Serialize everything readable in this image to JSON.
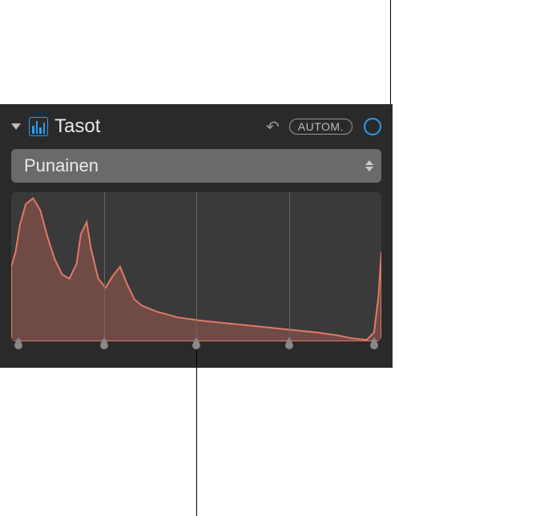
{
  "panel": {
    "title": "Tasot",
    "auto_label": "AUTOM.",
    "channel_selected": "Punainen"
  },
  "histogram": {
    "grid_positions_pct": [
      25,
      50,
      75
    ],
    "slider_positions_pct": [
      2,
      25,
      50,
      75,
      98
    ],
    "channel_color": "#d66a5a",
    "fill_color": "rgba(214,106,90,0.35)",
    "stroke_color": "#e07a68"
  },
  "chart_data": {
    "type": "area",
    "title": "",
    "xlabel": "",
    "ylabel": "",
    "x_range": [
      0,
      255
    ],
    "y_range": [
      0,
      100
    ],
    "series": [
      {
        "name": "Punainen",
        "points": [
          [
            0,
            50
          ],
          [
            3,
            60
          ],
          [
            6,
            78
          ],
          [
            10,
            92
          ],
          [
            15,
            96
          ],
          [
            20,
            88
          ],
          [
            25,
            70
          ],
          [
            30,
            55
          ],
          [
            35,
            45
          ],
          [
            40,
            42
          ],
          [
            45,
            52
          ],
          [
            48,
            72
          ],
          [
            52,
            80
          ],
          [
            55,
            62
          ],
          [
            60,
            42
          ],
          [
            65,
            36
          ],
          [
            70,
            44
          ],
          [
            75,
            50
          ],
          [
            80,
            38
          ],
          [
            85,
            28
          ],
          [
            90,
            24
          ],
          [
            100,
            20
          ],
          [
            115,
            16
          ],
          [
            130,
            14
          ],
          [
            150,
            12
          ],
          [
            170,
            10
          ],
          [
            190,
            8
          ],
          [
            210,
            6
          ],
          [
            225,
            4
          ],
          [
            235,
            2
          ],
          [
            245,
            1
          ],
          [
            250,
            6
          ],
          [
            253,
            30
          ],
          [
            255,
            60
          ]
        ]
      }
    ]
  }
}
